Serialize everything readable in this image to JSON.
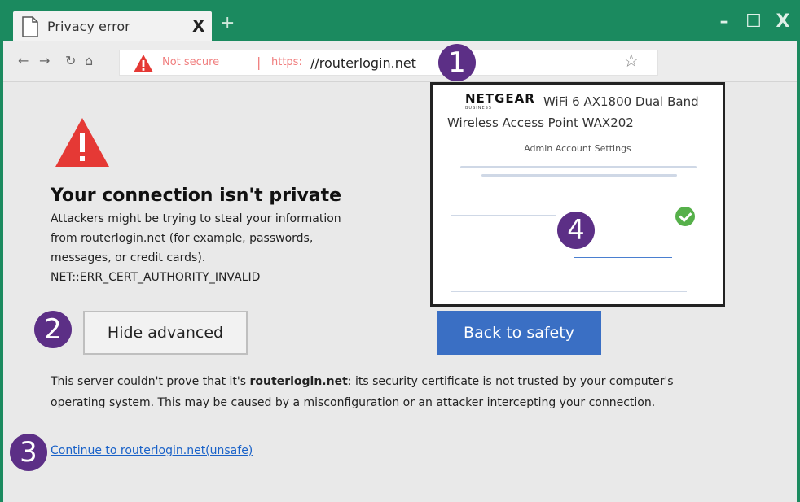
{
  "browser": {
    "tab_title": "Privacy error",
    "tab_close": "X",
    "new_tab": "+",
    "window_controls": {
      "minimize": "–",
      "maximize": "☐",
      "close": "X"
    },
    "address": {
      "not_secure": "Not secure",
      "separator": "|",
      "protocol": "https:",
      "host": "//routerlogin.net"
    }
  },
  "error_page": {
    "heading": "Your connection isn't private",
    "description_lines": [
      "Attackers might be trying to steal your information",
      "from routerlogin.net (for example, passwords,",
      "messages, or credit cards).",
      "NET::ERR_CERT_AUTHORITY_INVALID"
    ],
    "host_bold": "routerlogin.net",
    "hide_advanced_label": "Hide advanced",
    "back_to_safety_label": "Back to safety",
    "advanced_text_line1_prefix": "This server couldn't prove that it's ",
    "advanced_text_line1_suffix": ": its security certificate is not trusted by your computer's",
    "advanced_text_line2": "operating system. This may be caused by a misconfiguration or an attacker intercepting your connection.",
    "continue_link": "Continue to routerlogin.net(unsafe)"
  },
  "inset": {
    "logo": "NETGEAR",
    "logo_sub": "BUSINESS",
    "product": "WiFi 6 AX1800 Dual Band Wireless Access Point WAX202",
    "form_title": "Admin Account Settings"
  },
  "callouts": [
    "1",
    "2",
    "3",
    "4"
  ],
  "colors": {
    "frame": "#1b8a5f",
    "badge": "#5c2f86",
    "primary_button": "#3a6fc4",
    "warning": "#e53935",
    "link": "#1a62c8"
  }
}
